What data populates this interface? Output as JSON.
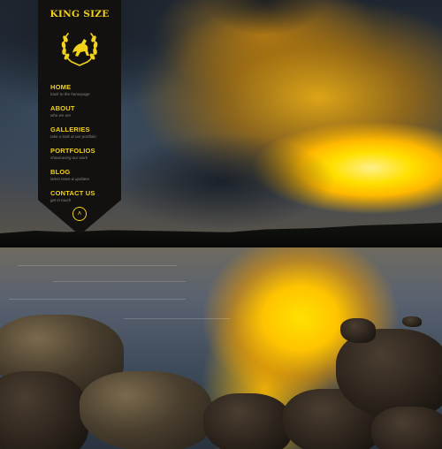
{
  "site": {
    "title": "KING SIZE",
    "emblem_icon": "laurel-wreath-horse-icon"
  },
  "colors": {
    "accent": "#f3d21a",
    "ribbon": "#121110",
    "subtext": "#8a8574"
  },
  "menu": {
    "items": [
      {
        "label": "HOME",
        "sub": "back to the homepage"
      },
      {
        "label": "ABOUT",
        "sub": "who we are"
      },
      {
        "label": "GALLERIES",
        "sub": "take a look at our portfolio"
      },
      {
        "label": "PORTFOLIOS",
        "sub": "showcasing our work"
      },
      {
        "label": "BLOG",
        "sub": "latest news & updates"
      },
      {
        "label": "CONTACT US",
        "sub": "get in touch"
      }
    ]
  },
  "controls": {
    "collapse_icon": "chevron-up-icon",
    "collapse_glyph": "˄"
  }
}
